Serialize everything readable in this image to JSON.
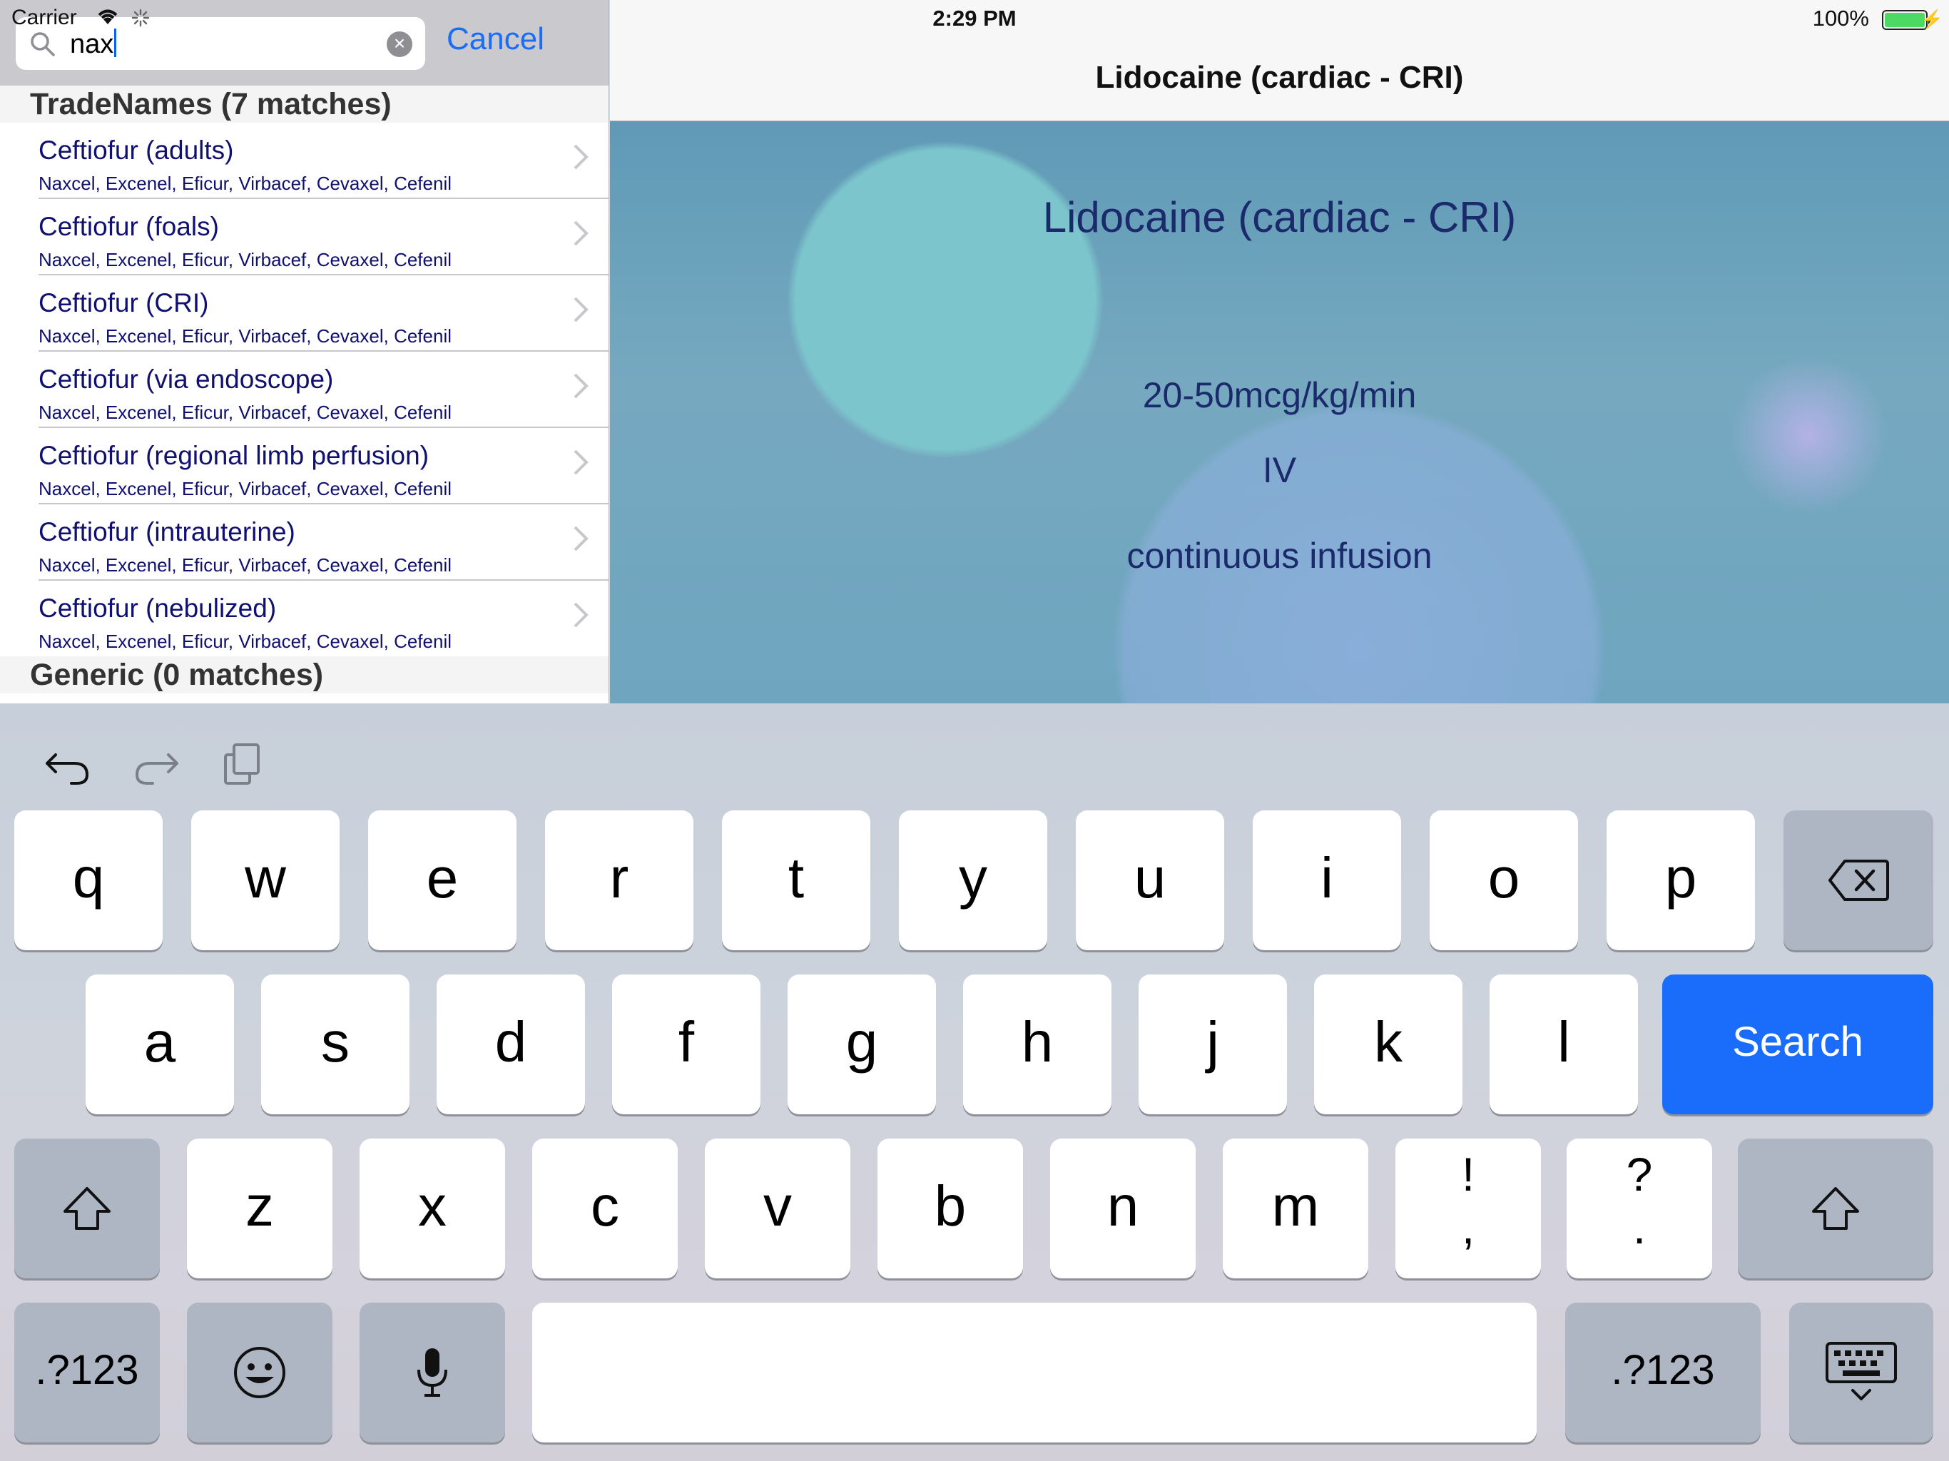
{
  "status_bar": {
    "carrier": "Carrier",
    "time": "2:29 PM",
    "battery": "100%"
  },
  "search": {
    "query": "nax",
    "cancel_label": "Cancel"
  },
  "results": {
    "tradenames_header": "TradeNames (7 matches)",
    "generic_header": "Generic (0 matches)",
    "items": [
      {
        "title": "Ceftiofur (adults)",
        "subtitle": "Naxcel, Excenel, Eficur, Virbacef, Cevaxel, Cefenil"
      },
      {
        "title": "Ceftiofur (foals)",
        "subtitle": "Naxcel, Excenel, Eficur, Virbacef, Cevaxel, Cefenil"
      },
      {
        "title": "Ceftiofur (CRI)",
        "subtitle": "Naxcel, Excenel, Eficur, Virbacef, Cevaxel, Cefenil"
      },
      {
        "title": "Ceftiofur (via endoscope)",
        "subtitle": "Naxcel, Excenel, Eficur, Virbacef, Cevaxel, Cefenil"
      },
      {
        "title": "Ceftiofur (regional limb perfusion)",
        "subtitle": "Naxcel, Excenel, Eficur, Virbacef, Cevaxel, Cefenil"
      },
      {
        "title": "Ceftiofur (intrauterine)",
        "subtitle": "Naxcel, Excenel, Eficur, Virbacef, Cevaxel, Cefenil"
      },
      {
        "title": "Ceftiofur (nebulized)",
        "subtitle": "Naxcel, Excenel, Eficur, Virbacef, Cevaxel, Cefenil"
      }
    ]
  },
  "detail": {
    "nav_title": "Lidocaine (cardiac - CRI)",
    "heading": "Lidocaine (cardiac - CRI)",
    "dose": "20-50mcg/kg/min",
    "route": "IV",
    "frequency": "continuous infusion"
  },
  "keyboard": {
    "row1": [
      "q",
      "w",
      "e",
      "r",
      "t",
      "y",
      "u",
      "i",
      "o",
      "p"
    ],
    "row2": [
      "a",
      "s",
      "d",
      "f",
      "g",
      "h",
      "j",
      "k",
      "l"
    ],
    "row3": [
      "z",
      "x",
      "c",
      "v",
      "b",
      "n",
      "m"
    ],
    "punct1": {
      "top": "!",
      "bottom": ","
    },
    "punct2": {
      "top": "?",
      "bottom": "."
    },
    "search_label": "Search",
    "numbers_label": ".?123",
    "accent_color": "#1a6cfb"
  }
}
